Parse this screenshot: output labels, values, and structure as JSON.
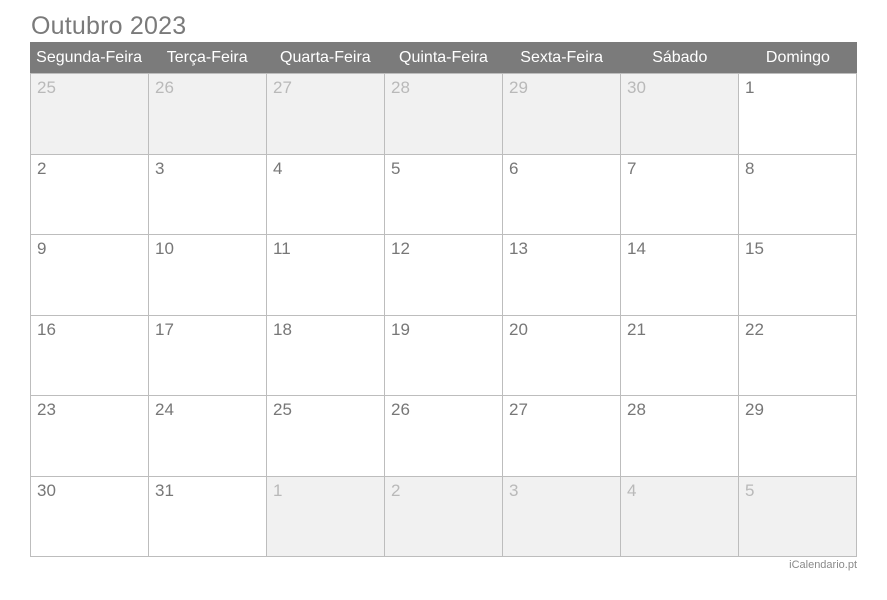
{
  "title": "Outubro 2023",
  "weekdays": [
    "Segunda-Feira",
    "Terça-Feira",
    "Quarta-Feira",
    "Quinta-Feira",
    "Sexta-Feira",
    "Sábado",
    "Domingo"
  ],
  "weeks": [
    [
      {
        "day": "25",
        "outside": true
      },
      {
        "day": "26",
        "outside": true
      },
      {
        "day": "27",
        "outside": true
      },
      {
        "day": "28",
        "outside": true
      },
      {
        "day": "29",
        "outside": true
      },
      {
        "day": "30",
        "outside": true
      },
      {
        "day": "1",
        "outside": false
      }
    ],
    [
      {
        "day": "2",
        "outside": false
      },
      {
        "day": "3",
        "outside": false
      },
      {
        "day": "4",
        "outside": false
      },
      {
        "day": "5",
        "outside": false
      },
      {
        "day": "6",
        "outside": false
      },
      {
        "day": "7",
        "outside": false
      },
      {
        "day": "8",
        "outside": false
      }
    ],
    [
      {
        "day": "9",
        "outside": false
      },
      {
        "day": "10",
        "outside": false
      },
      {
        "day": "11",
        "outside": false
      },
      {
        "day": "12",
        "outside": false
      },
      {
        "day": "13",
        "outside": false
      },
      {
        "day": "14",
        "outside": false
      },
      {
        "day": "15",
        "outside": false
      }
    ],
    [
      {
        "day": "16",
        "outside": false
      },
      {
        "day": "17",
        "outside": false
      },
      {
        "day": "18",
        "outside": false
      },
      {
        "day": "19",
        "outside": false
      },
      {
        "day": "20",
        "outside": false
      },
      {
        "day": "21",
        "outside": false
      },
      {
        "day": "22",
        "outside": false
      }
    ],
    [
      {
        "day": "23",
        "outside": false
      },
      {
        "day": "24",
        "outside": false
      },
      {
        "day": "25",
        "outside": false
      },
      {
        "day": "26",
        "outside": false
      },
      {
        "day": "27",
        "outside": false
      },
      {
        "day": "28",
        "outside": false
      },
      {
        "day": "29",
        "outside": false
      }
    ],
    [
      {
        "day": "30",
        "outside": false
      },
      {
        "day": "31",
        "outside": false
      },
      {
        "day": "1",
        "outside": true
      },
      {
        "day": "2",
        "outside": true
      },
      {
        "day": "3",
        "outside": true
      },
      {
        "day": "4",
        "outside": true
      },
      {
        "day": "5",
        "outside": true
      }
    ]
  ],
  "footer": "iCalendario.pt",
  "colors": {
    "header_bg": "#7b7b7b",
    "outside_day_bg": "#f1f1f1",
    "grid_line": "#bdbdbd",
    "text": "#777777"
  }
}
